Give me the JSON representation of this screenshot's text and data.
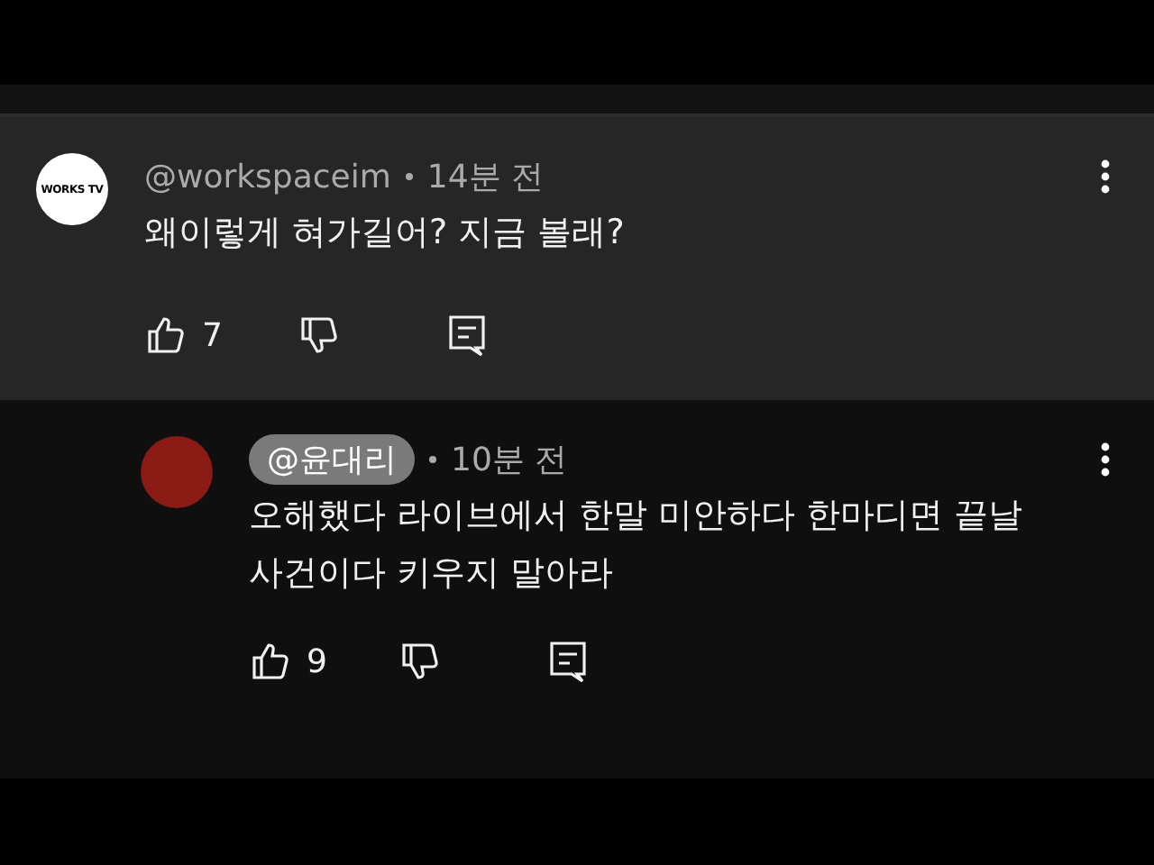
{
  "comments": [
    {
      "avatar": {
        "kind": "logo",
        "text": "WORKS TV"
      },
      "author": "@workspaceim",
      "author_highlighted": false,
      "time": "14분 전",
      "text": "왜이렇게 혀가길어? 지금 볼래?",
      "likes": "7",
      "reply": false
    },
    {
      "avatar": {
        "kind": "photo"
      },
      "author": "@윤대리",
      "author_highlighted": true,
      "time": "10분 전",
      "text": "오해했다 라이브에서 한말 미안하다 한마디면 끝날 사건이다 키우지 말아라",
      "likes": "9",
      "reply": true
    }
  ]
}
